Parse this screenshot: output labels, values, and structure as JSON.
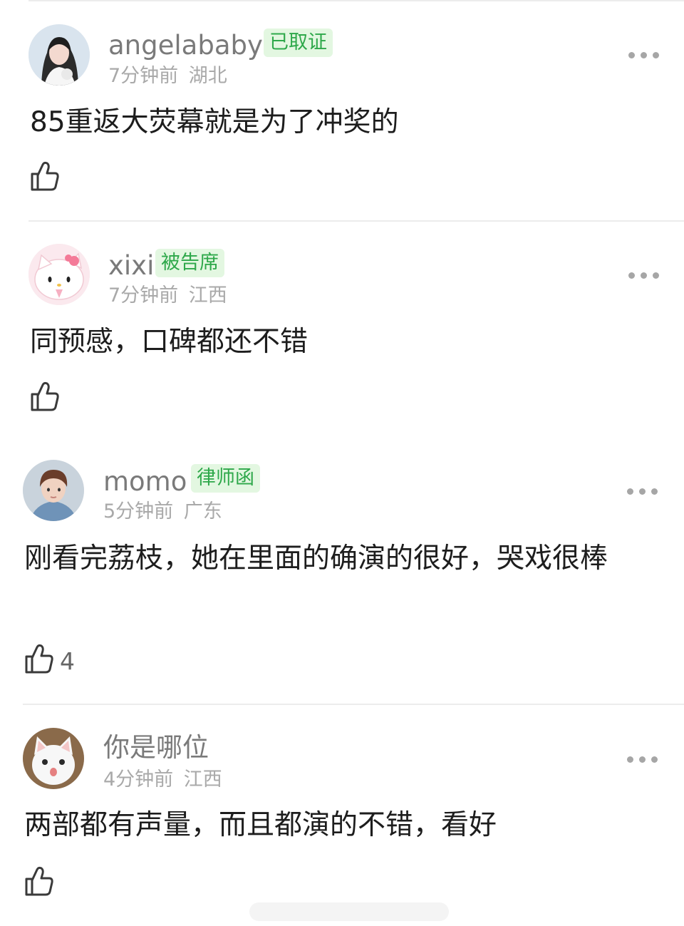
{
  "comments": [
    {
      "name": "angelababy",
      "badge": "已取证",
      "time": "7分钟前",
      "location": "湖北",
      "text": "85重返大荧幕就是为了冲奖的",
      "likes": "",
      "avatar_icon": "girl-portrait-avatar"
    },
    {
      "name": "xixi",
      "badge": "被告席",
      "time": "7分钟前",
      "location": "江西",
      "text": "同预感，口碑都还不错",
      "likes": "",
      "avatar_icon": "hello-kitty-avatar"
    },
    {
      "name": "momo",
      "badge": "律师函",
      "time": "5分钟前",
      "location": "广东",
      "text": "刚看完荔枝，她在里面的确演的很好，哭戏很棒",
      "likes": "4",
      "avatar_icon": "boy-portrait-avatar"
    },
    {
      "name": "你是哪位",
      "badge": "",
      "time": "4分钟前",
      "location": "江西",
      "text": "两部都有声量，而且都演的不错，看好",
      "likes": "",
      "avatar_icon": "white-cat-avatar"
    }
  ],
  "colors": {
    "badge_bg": "#e3f7e1",
    "badge_text": "#2ea84a",
    "name_text": "#7a7a7a",
    "meta_text": "#a9a9a9"
  },
  "icons": {
    "like": "thumbs-up-icon",
    "more": "more-dots-icon"
  }
}
